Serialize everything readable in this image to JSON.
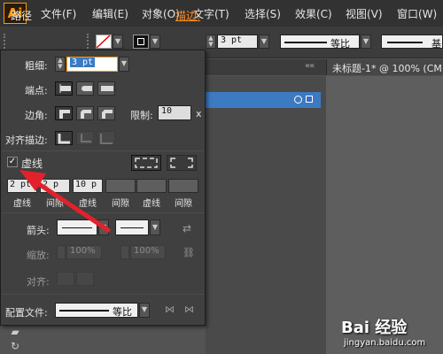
{
  "app": {
    "logo": "Ai"
  },
  "menu": {
    "items": [
      "文件(F)",
      "编辑(E)",
      "对象(O)",
      "文字(T)",
      "选择(S)",
      "效果(C)",
      "视图(V)",
      "窗口(W)"
    ]
  },
  "control_bar": {
    "path_label": "路径",
    "stroke_link": "描边:",
    "stroke_value": "3 pt",
    "profile_1": "等比",
    "profile_2": "基"
  },
  "document": {
    "tab_title": "未标题-1* @ 100% (CM"
  },
  "stroke_panel": {
    "weight_label": "粗细:",
    "weight_value": "3 pt",
    "cap_label": "端点:",
    "corner_label": "边角:",
    "limit_label": "限制:",
    "limit_value": "10",
    "limit_unit": "x",
    "align_label": "对齐描边:",
    "dashed_label": "虚线",
    "dashed_checked": true,
    "dash_values": [
      "2 pt",
      "2 p",
      "10 p",
      "",
      "",
      ""
    ],
    "dash_captions": [
      "虚线",
      "间隙",
      "虚线",
      "间隙",
      "虚线",
      "间隙"
    ],
    "arrow_label": "箭头:",
    "scale_label": "缩放:",
    "scale_start": "100%",
    "scale_end": "100%",
    "align_arrow_label": "对齐:",
    "profile_label": "配置文件:",
    "profile_value": "等比"
  },
  "watermark": {
    "main": "Bai 经验",
    "sub": "jingyan.baidu.com"
  },
  "colors": {
    "accent": "#ff8c1a",
    "selection": "#3c7ac2",
    "panel": "#404040",
    "annotation_arrow": "#e3212b"
  }
}
